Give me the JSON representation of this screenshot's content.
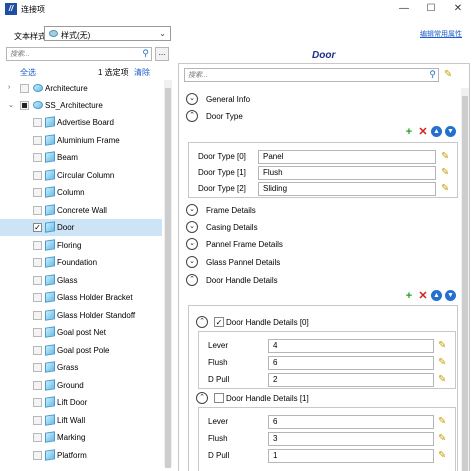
{
  "window": {
    "title": "连接项",
    "minimize": "—",
    "maximize": "☐",
    "close": "✕"
  },
  "left": {
    "style_label": "文本样式:",
    "style_value": "样式(无)",
    "search_placeholder": "搜索...",
    "more_label": "...",
    "select_all": "全选",
    "selected_count": "1 选定项",
    "clear": "清除",
    "tree": {
      "root": "Architecture",
      "catalog": "SS_Architecture",
      "items": [
        {
          "label": "Advertise Board",
          "checked": false
        },
        {
          "label": "Aluminium Frame",
          "checked": false
        },
        {
          "label": "Beam",
          "checked": false
        },
        {
          "label": "Circular Column",
          "checked": false
        },
        {
          "label": "Column",
          "checked": false
        },
        {
          "label": "Concrete Wall",
          "checked": false
        },
        {
          "label": "Door",
          "checked": true
        },
        {
          "label": "Floring",
          "checked": false
        },
        {
          "label": "Foundation",
          "checked": false
        },
        {
          "label": "Glass",
          "checked": false
        },
        {
          "label": "Glass Holder Bracket",
          "checked": false
        },
        {
          "label": "Glass Holder Standoff",
          "checked": false
        },
        {
          "label": "Goal post Net",
          "checked": false
        },
        {
          "label": "Goal post Pole",
          "checked": false
        },
        {
          "label": "Grass",
          "checked": false
        },
        {
          "label": "Ground",
          "checked": false
        },
        {
          "label": "Lift Door",
          "checked": false
        },
        {
          "label": "Lift Wall",
          "checked": false
        },
        {
          "label": "Marking",
          "checked": false
        },
        {
          "label": "Platform",
          "checked": false
        }
      ]
    }
  },
  "right": {
    "edit_link": "编辑常用属性",
    "object_title": "Door",
    "search_placeholder": "搜索...",
    "sections": {
      "general_info": "General Info",
      "door_type": "Door Type",
      "frame_details": "Frame Details",
      "casing_details": "Casing Details",
      "pannel_frame_details": "Pannel Frame Details",
      "glass_pannel_details": "Glass Pannel Details",
      "door_handle_details": "Door Handle Details"
    },
    "door_type_rows": [
      {
        "name": "Door Type [0]",
        "value": "Panel"
      },
      {
        "name": "Door Type [1]",
        "value": "Flush"
      },
      {
        "name": "Door Type [2]",
        "value": "Sliding"
      }
    ],
    "handle_groups": [
      {
        "title": "Door Handle Details [0]",
        "checked": true,
        "rows": [
          {
            "name": "Lever",
            "value": "4"
          },
          {
            "name": "Flush",
            "value": "6"
          },
          {
            "name": "D Pull",
            "value": "2"
          }
        ]
      },
      {
        "title": "Door Handle Details [1]",
        "checked": false,
        "rows": [
          {
            "name": "Lever",
            "value": "6"
          },
          {
            "name": "Flush",
            "value": "3"
          },
          {
            "name": "D Pull",
            "value": "1"
          }
        ]
      }
    ],
    "toolbar": {
      "add": "+",
      "delete": "✕",
      "up": "▲",
      "down": "▼"
    },
    "colors": {
      "link": "#1e5ec8",
      "title": "#1a2f8a",
      "selection": "#cde4f7",
      "add": "#28a028",
      "delete": "#d42020"
    }
  }
}
